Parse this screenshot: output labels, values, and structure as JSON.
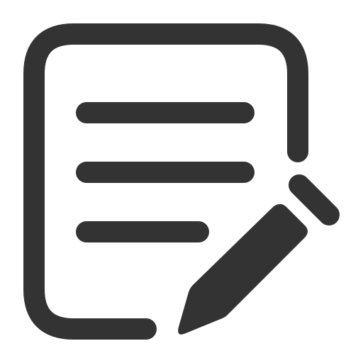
{
  "icon": {
    "name": "edit-document-icon",
    "color": "#333333",
    "background": "#ffffff"
  }
}
